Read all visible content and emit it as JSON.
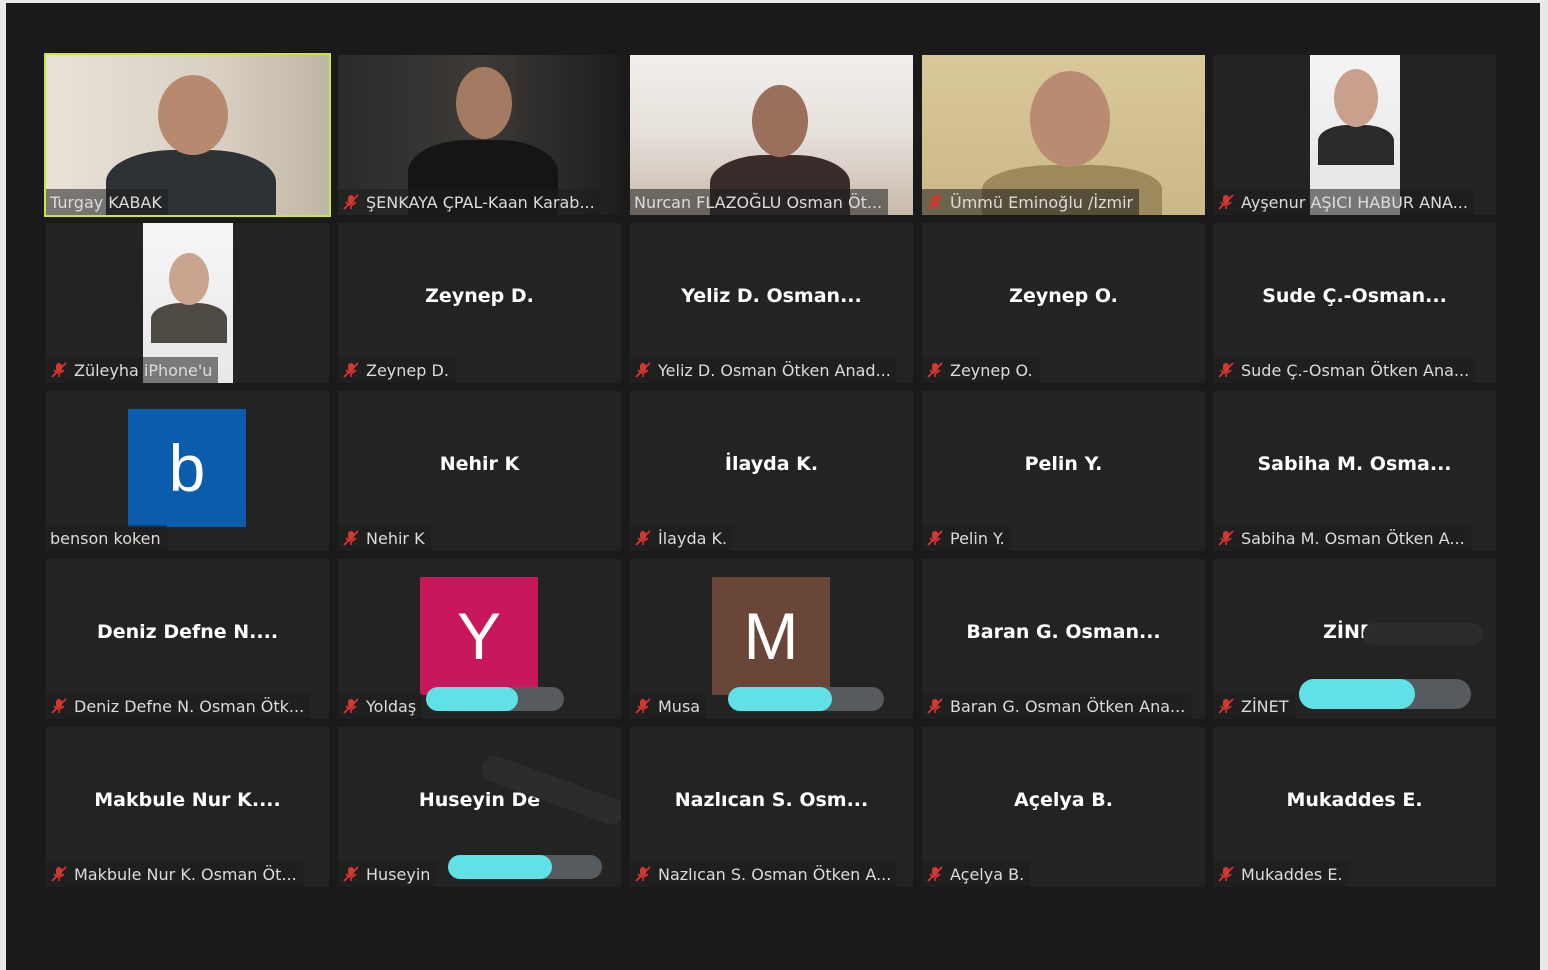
{
  "meeting": {
    "active_speaker_color": "#c9e34f",
    "participants": [
      {
        "label": "Turgay KABAK",
        "video": true,
        "active": true,
        "muted": false
      },
      {
        "label": "ŞENKAYA ÇPAL-Kaan Karab...",
        "video": true,
        "muted": true
      },
      {
        "label": "Nurcan  FLAZOĞLU Osman Öt...",
        "video": true,
        "muted": false
      },
      {
        "label": "Ümmü Eminoğlu /İzmir",
        "video": true,
        "muted": true
      },
      {
        "label": "Ayşenur AŞICI HABUR ANA...",
        "video": true,
        "muted": true
      },
      {
        "label": "Züleyha iPhone'u",
        "video": true,
        "muted": true
      },
      {
        "label": "Zeynep D.",
        "display_name": "Zeynep D.",
        "muted": true
      },
      {
        "label": "Yeliz D. Osman Ötken Anad...",
        "display_name": "Yeliz  D.  Osman...",
        "muted": true
      },
      {
        "label": "Zeynep O.",
        "display_name": "Zeynep O.",
        "muted": true
      },
      {
        "label": "Sude Ç.-Osman Ötken Ana...",
        "display_name": "Sude  Ç.-Osman...",
        "muted": true
      },
      {
        "label": "benson koken",
        "avatar_letter": "b",
        "avatar_color": "#0a5cad",
        "muted": false
      },
      {
        "label": "Nehir K",
        "display_name": "Nehir K",
        "muted": true
      },
      {
        "label": "İlayda K.",
        "display_name": "İlayda K.",
        "muted": true
      },
      {
        "label": "Pelin Y.",
        "display_name": "Pelin Y.",
        "muted": true
      },
      {
        "label": "Sabiha M. Osman Ötken A...",
        "display_name": "Sabiha  M.  Osma...",
        "muted": true
      },
      {
        "label": "Deniz Defne N. Osman Ötk...",
        "display_name": "Deniz  Defne  N....",
        "muted": true
      },
      {
        "label": "Yoldaş",
        "avatar_letter": "Y",
        "avatar_color": "#c8185b",
        "muted": true,
        "redacted": true
      },
      {
        "label": "Musa",
        "avatar_letter": "M",
        "avatar_color": "#6a4638",
        "muted": true,
        "redacted": true
      },
      {
        "label": "Baran G. Osman Ötken Ana...",
        "display_name": "Baran  G.  Osman...",
        "muted": true
      },
      {
        "label": "ZİNET",
        "display_name": "ZİNET",
        "muted": true,
        "redacted": true
      },
      {
        "label": "Makbule Nur K. Osman Öt...",
        "display_name": "Makbule  Nur  K....",
        "muted": true
      },
      {
        "label": "Huseyin",
        "display_name": "Huseyin De",
        "muted": true,
        "redacted": true
      },
      {
        "label": "Nazlıcan S. Osman Ötken A...",
        "display_name": "Nazlıcan  S.  Osm...",
        "muted": true
      },
      {
        "label": "Açelya B.",
        "display_name": "Açelya B.",
        "muted": true
      },
      {
        "label": "Mukaddes E.",
        "display_name": "Mukaddes E.",
        "muted": true
      }
    ]
  }
}
